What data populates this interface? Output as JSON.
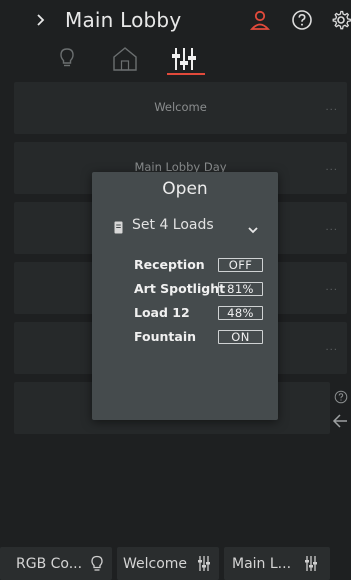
{
  "header": {
    "title": "Main Lobby",
    "expand_icon": "chevron-right-icon",
    "user_icon": "user-alert-icon",
    "help_icon": "help-circle-icon",
    "settings_icon": "gear-icon",
    "accent_color": "#e24a3b"
  },
  "tabs": [
    {
      "icon": "lightbulb-icon",
      "active": false
    },
    {
      "icon": "home-icon",
      "active": false
    },
    {
      "icon": "sliders-icon",
      "active": true
    }
  ],
  "scenes": [
    {
      "label": "Welcome",
      "more": "..."
    },
    {
      "label": "Main Lobby Day",
      "more": "..."
    },
    {
      "label": "",
      "more": "..."
    },
    {
      "label": "",
      "more": "..."
    },
    {
      "label": "",
      "more": "..."
    },
    {
      "label": "",
      "more": ""
    }
  ],
  "side_icons": [
    "help-circle-icon",
    "arrow-left-icon"
  ],
  "modal": {
    "title": "Open",
    "select": {
      "icon": "file-icon",
      "label": "Set 4 Loads",
      "chevron": "chevron-down-icon"
    },
    "loads": [
      {
        "name": "Reception",
        "value": "OFF"
      },
      {
        "name": "Art Spotlight",
        "value": "81%"
      },
      {
        "name": "Load 12",
        "value": "48%"
      },
      {
        "name": "Fountain",
        "value": "ON"
      }
    ]
  },
  "bottom_bar": [
    {
      "label": "RGB Co...",
      "icon": "lightbulb-icon"
    },
    {
      "label": "Welcome",
      "icon": "sliders-icon"
    },
    {
      "label": "Main L...",
      "icon": "sliders-icon"
    }
  ]
}
